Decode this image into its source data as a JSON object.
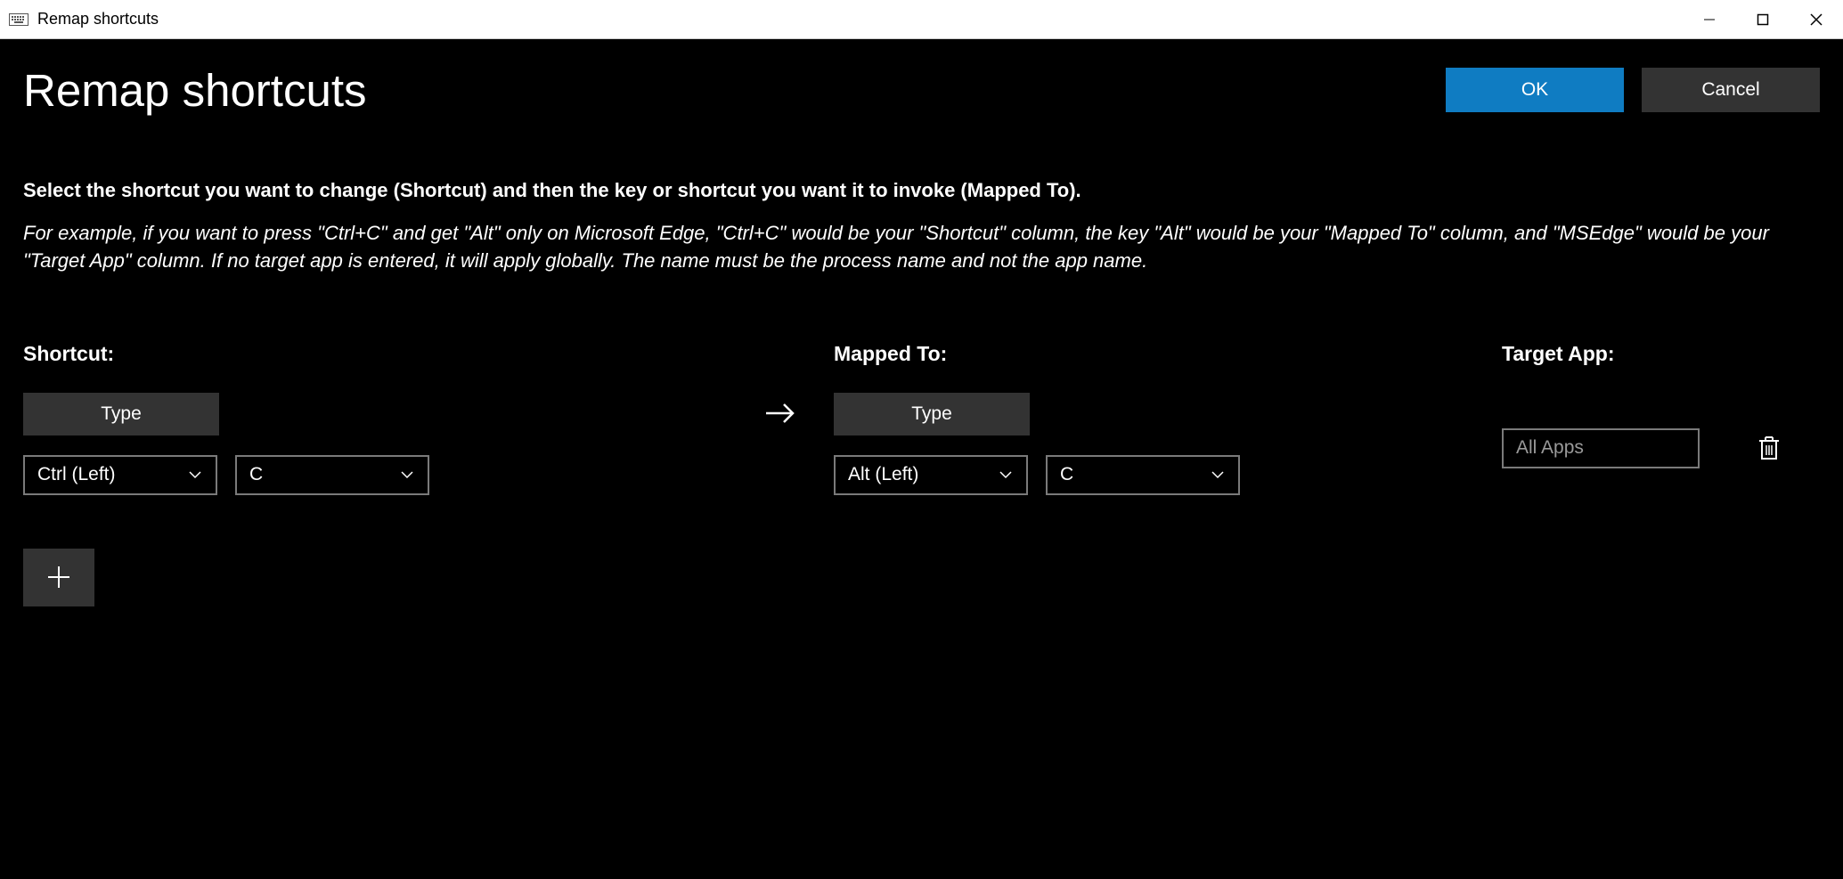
{
  "window": {
    "title": "Remap shortcuts"
  },
  "page": {
    "title": "Remap shortcuts",
    "ok_label": "OK",
    "cancel_label": "Cancel",
    "description_bold": "Select the shortcut you want to change (Shortcut) and then the key or shortcut you want it to invoke (Mapped To).",
    "description_italic": "For example, if you want to press \"Ctrl+C\" and get \"Alt\" only on Microsoft Edge, \"Ctrl+C\" would be your \"Shortcut\" column, the key \"Alt\" would be your \"Mapped To\" column, and \"MSEdge\" would be your \"Target App\" column. If no target app is entered, it will apply globally. The name must be the process name and not the app name."
  },
  "columns": {
    "shortcut": {
      "header": "Shortcut:",
      "type_label": "Type",
      "key1": "Ctrl (Left)",
      "key2": "C"
    },
    "mapped": {
      "header": "Mapped To:",
      "type_label": "Type",
      "key1": "Alt (Left)",
      "key2": "C"
    },
    "target": {
      "header": "Target App:",
      "placeholder": "All Apps"
    }
  }
}
